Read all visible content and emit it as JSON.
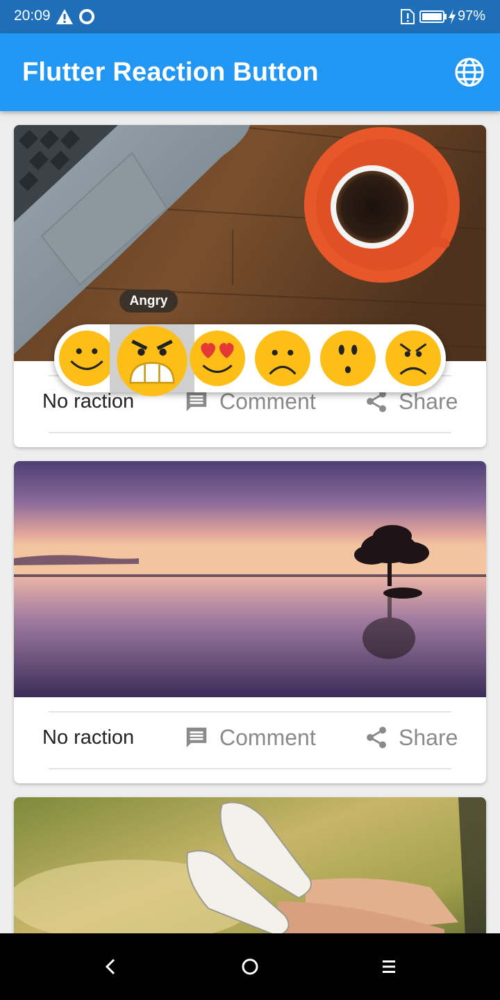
{
  "status_bar": {
    "time": "20:09",
    "battery": "97%",
    "icons": [
      "warning-icon",
      "ring-icon",
      "sim-alert-icon",
      "battery-icon",
      "charging-bolt-icon"
    ]
  },
  "app_bar": {
    "title": "Flutter Reaction Button",
    "action_icon": "globe-icon"
  },
  "reaction_picker": {
    "tooltip": "Angry",
    "highlighted_index": 1,
    "emojis": [
      "smile",
      "angry",
      "love",
      "sad",
      "surprised",
      "mad"
    ]
  },
  "posts": [
    {
      "image": "laptop-and-coffee-photo",
      "reaction": "No raction",
      "comment_label": "Comment",
      "share_label": "Share"
    },
    {
      "image": "sunset-lake-tree-photo",
      "reaction": "No raction",
      "comment_label": "Comment",
      "share_label": "Share"
    },
    {
      "image": "sneakers-feet-photo"
    }
  ],
  "nav_bar": {
    "icons": [
      "back-icon",
      "home-icon",
      "menu-icon"
    ]
  },
  "colors": {
    "status_bar": "#1f6fb8",
    "app_bar": "#2196f3",
    "background": "#ededed",
    "emoji_yellow": "#fdbf17",
    "muted_text": "#8a8a8a"
  }
}
